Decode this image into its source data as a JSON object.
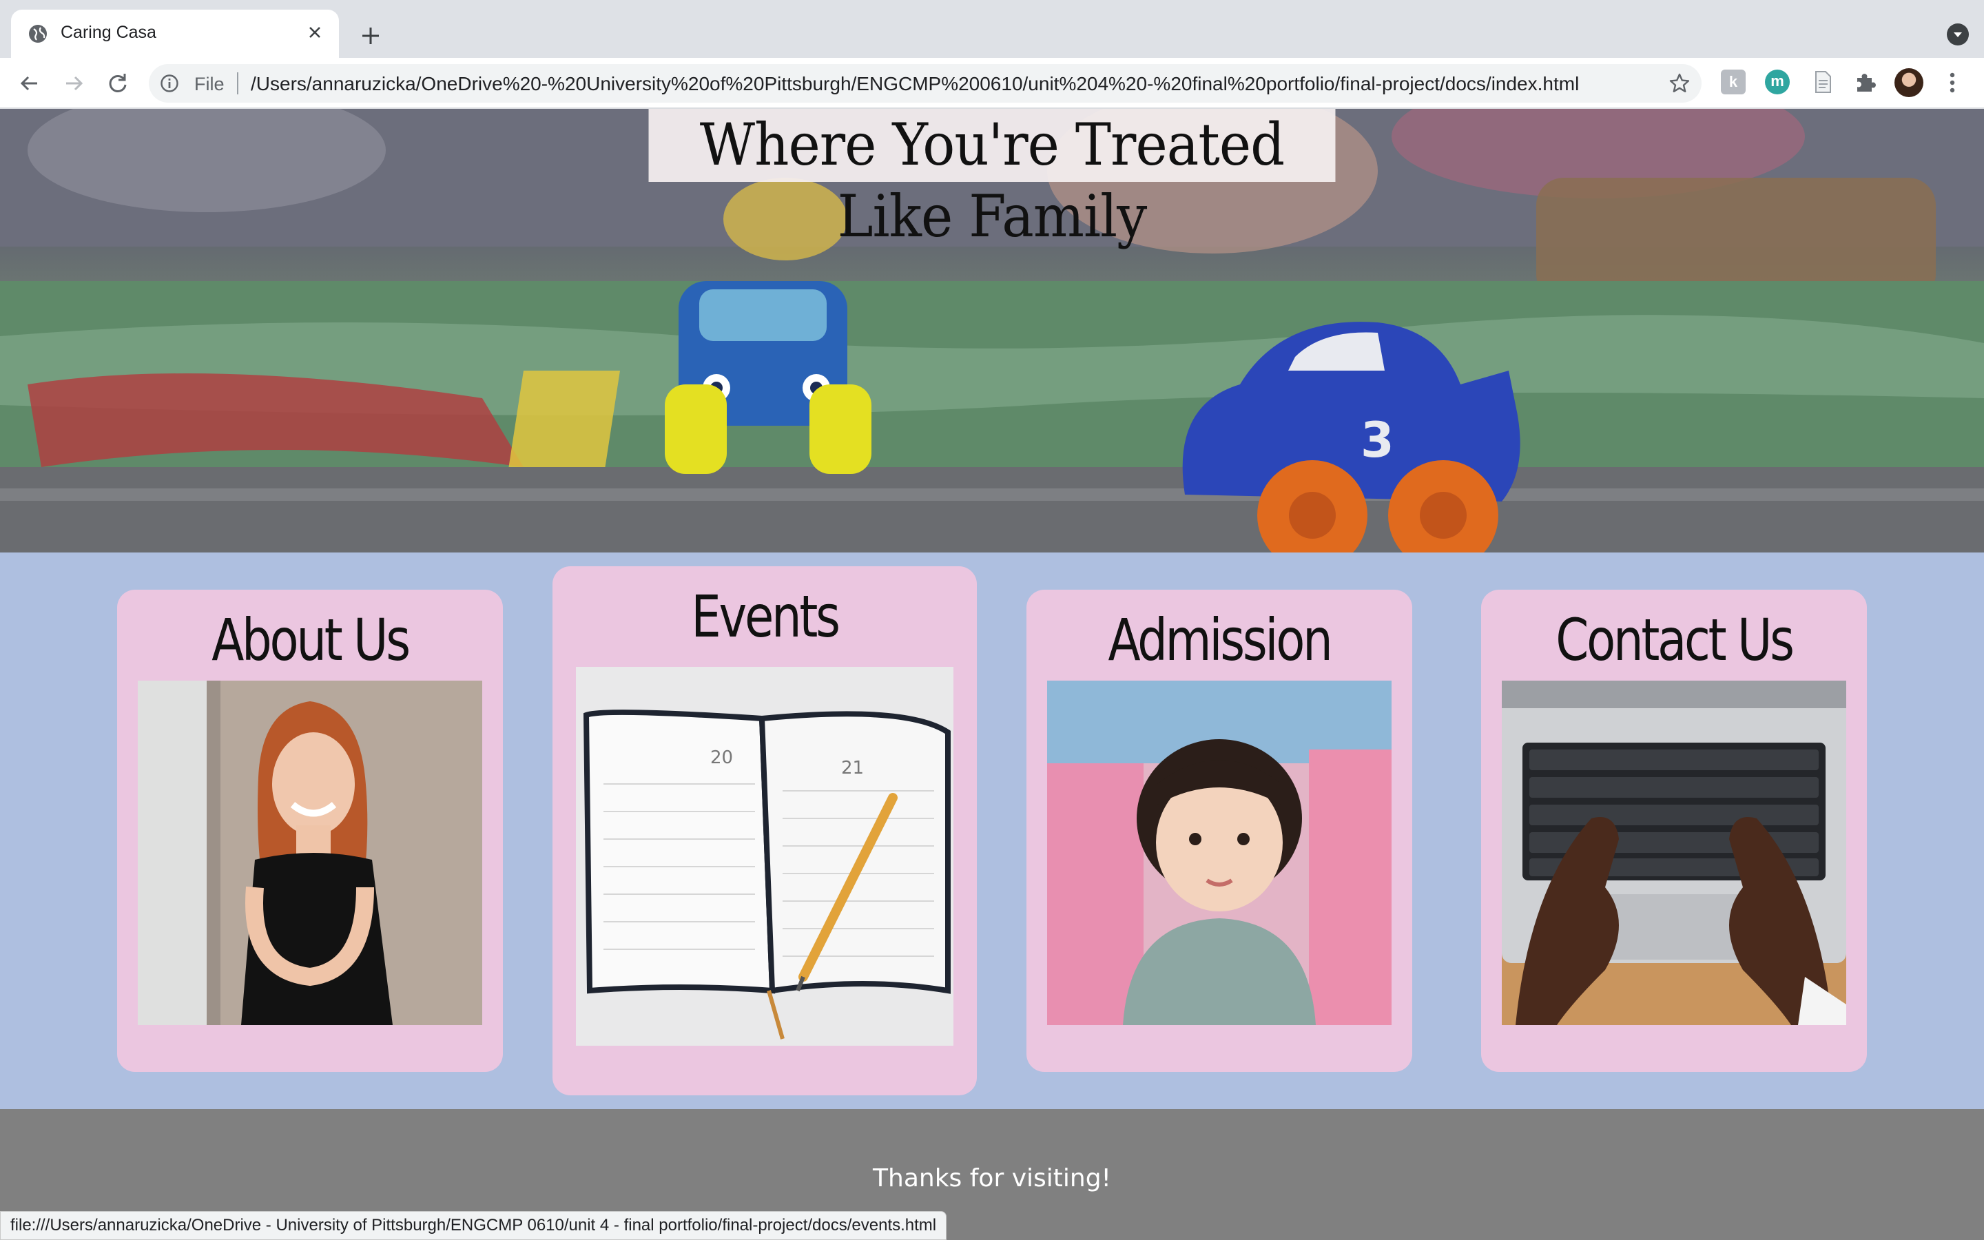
{
  "browser": {
    "tab_title": "Caring Casa",
    "omnibox_scheme": "File",
    "url": "/Users/annaruzicka/OneDrive%20-%20University%20of%20Pittsburgh/ENGCMP%200610/unit%204%20-%20final%20portfolio/final-project/docs/index.html",
    "extensions": [
      "k-extension-icon",
      "m-extension-icon",
      "document-extension-icon",
      "puzzle-icon"
    ],
    "ext_k_label": "k",
    "ext_m_label": "m"
  },
  "hero": {
    "title": "Where You're Treated Like Family"
  },
  "cards": [
    {
      "title": "About Us",
      "image": "smiling woman"
    },
    {
      "title": "Events",
      "image": "open planner with pencil"
    },
    {
      "title": "Admission",
      "image": "toddler"
    },
    {
      "title": "Contact Us",
      "image": "hands typing on laptop"
    }
  ],
  "footer": {
    "text": "Thanks for visiting!"
  },
  "status_bar": {
    "text": "file:///Users/annaruzicka/OneDrive - University of Pittsburgh/ENGCMP 0610/unit 4 - final portfolio/final-project/docs/events.html"
  },
  "colors": {
    "page_background": "#aebfe0",
    "card_background": "#ebc6e0",
    "footer_background": "#808080"
  }
}
